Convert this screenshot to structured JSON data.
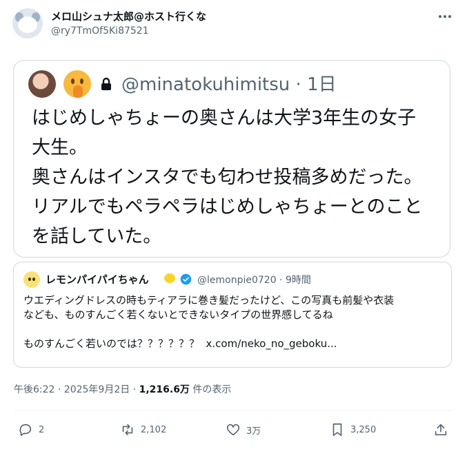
{
  "post": {
    "display_name": "メロ山シュナ太郎@ホスト行くな",
    "handle": "@ry7TmOf5Ki87521",
    "timestamp": "午後6:22 · 2025年9月2日 · ",
    "views_count": "1,216.6万",
    "views_label": " 件の表示"
  },
  "embedded": {
    "handle_time": "@minatokuhimitsu · 1日",
    "text": "はじめしゃちょーの奥さんは大学3年生の女子\n大生。\n奥さんはインスタでも匂わせ投稿多めだった。\nリアルでもペラペラはじめしゃちょーとのこと\nを話していた。"
  },
  "quote": {
    "name": "レモンパイパイちゃん",
    "meta": "@lemonpie0720 · 9時間",
    "body": "ウエディングドレスの時もティアラに巻き髪だったけど、この写真も前髪や衣装\nなども、ものすんごく若くないとできないタイプの世界感してるね\n\nものすんごく若いのでは？？？？？？  x.com/neko_no_geboku..."
  },
  "actions": {
    "reply": "2",
    "repost": "2,102",
    "like": "3万",
    "bookmark": "3,250"
  },
  "colors": {
    "text": "#0f1419",
    "secondary": "#536471",
    "border": "#cfd9de",
    "verified": "#1d9bf0"
  },
  "icons": [
    "more-icon",
    "lock-icon",
    "verified-badge-icon",
    "reply-icon",
    "repost-icon",
    "like-icon",
    "bookmark-icon",
    "share-icon"
  ]
}
